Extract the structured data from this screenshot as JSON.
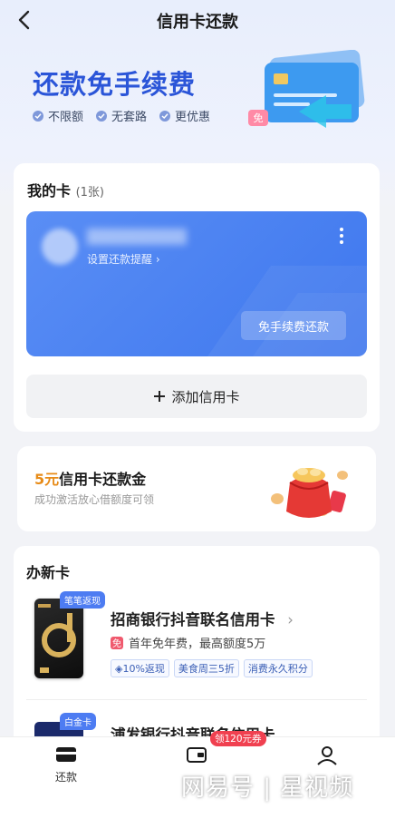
{
  "header": {
    "title": "信用卡还款"
  },
  "hero": {
    "headline": "还款免手续费",
    "benefits": [
      "不限额",
      "无套路",
      "更优惠"
    ],
    "card_badge": "免"
  },
  "my_cards": {
    "title": "我的卡",
    "count": "(1张)",
    "card": {
      "remind_label": "设置还款提醒 ›",
      "pay_button": "免手续费还款"
    },
    "add_button": "添加信用卡"
  },
  "repay_gold": {
    "amount": "5元",
    "title": "信用卡还款金",
    "subtitle": "成功激活放心借额度可领"
  },
  "new_card": {
    "title": "办新卡",
    "items": [
      {
        "tag": "笔笔返现",
        "name": "招商银行抖音联名信用卡",
        "free_icon": "免",
        "desc": "首年免年费，最高额度5万",
        "chips": [
          "10%返现",
          "美食周三5折",
          "消费永久积分"
        ]
      },
      {
        "tag": "白金卡",
        "name": "浦发银行抖音联名信用卡"
      }
    ]
  },
  "tabbar": {
    "tabs": [
      {
        "label": "还款",
        "icon": "card-icon"
      },
      {
        "label": "",
        "icon": "wallet-icon"
      },
      {
        "label": "",
        "icon": "user-icon"
      }
    ],
    "badge": "领120元券"
  },
  "watermark": "网易号 | 星视频",
  "colors": {
    "accent": "#3e77ee",
    "gold": "#e78b18",
    "badge": "#f04050"
  }
}
